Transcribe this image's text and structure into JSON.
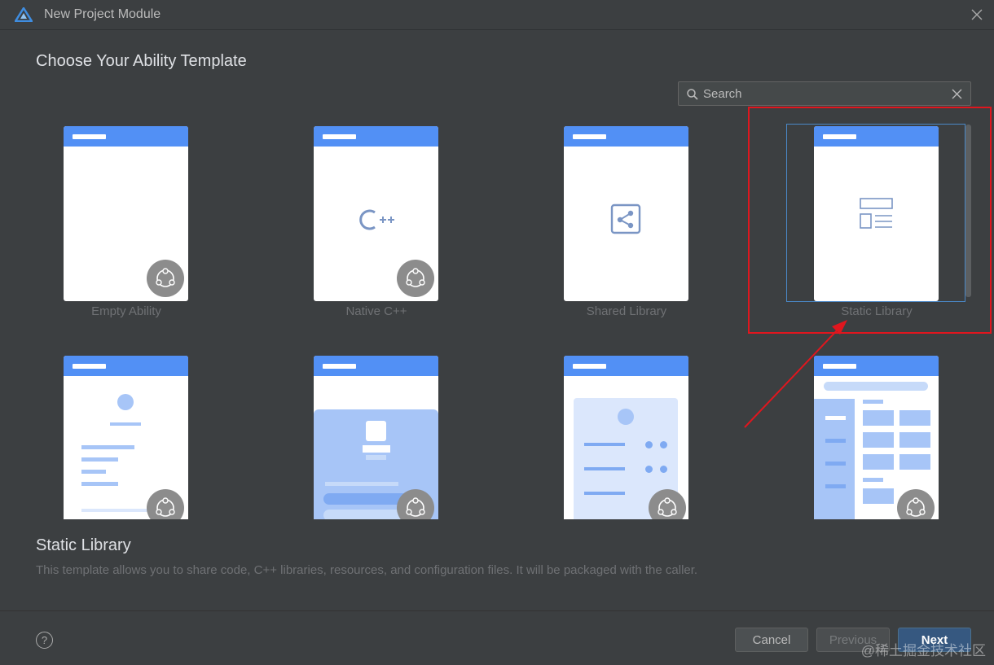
{
  "window": {
    "title": "New Project Module"
  },
  "heading": "Choose Your Ability Template",
  "search": {
    "placeholder": "Search"
  },
  "templates": [
    {
      "label": "Empty Ability",
      "selected": false
    },
    {
      "label": "Native C++",
      "selected": false
    },
    {
      "label": "Shared Library",
      "selected": false
    },
    {
      "label": "Static Library",
      "selected": true
    },
    {
      "label": "",
      "selected": false
    },
    {
      "label": "",
      "selected": false
    },
    {
      "label": "",
      "selected": false
    },
    {
      "label": "",
      "selected": false
    }
  ],
  "description": {
    "title": "Static Library",
    "text": "This template allows you to share code, C++ libraries, resources, and configuration files. It will be packaged with the caller."
  },
  "footer": {
    "help_label": "?",
    "cancel_label": "Cancel",
    "previous_label": "Previous",
    "next_label": "Next"
  },
  "watermark": "@稀土掘金技术社区",
  "colors": {
    "accent": "#5290f5",
    "annotation": "#e0161e",
    "background": "#3c3f41"
  },
  "icons": [
    "app-logo-icon",
    "close-icon",
    "search-icon",
    "clear-icon",
    "cpp-icon",
    "share-icon",
    "layout-icon",
    "template-badge-icon",
    "help-icon"
  ]
}
